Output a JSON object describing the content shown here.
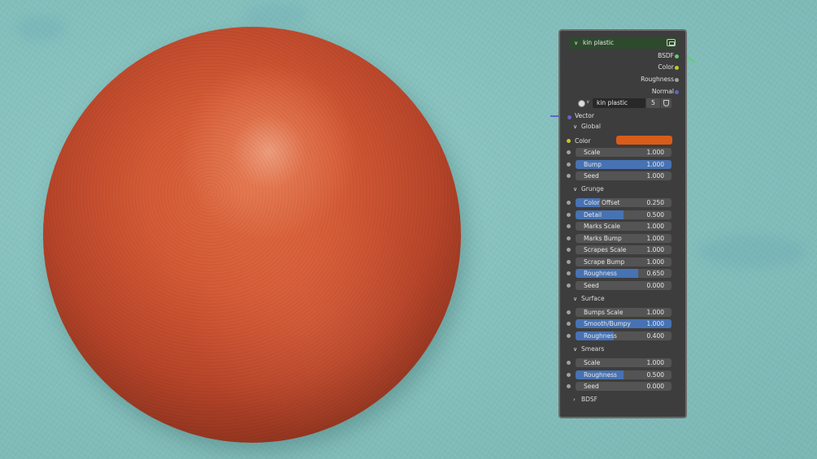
{
  "node": {
    "title": "kin plastic",
    "outputs": [
      {
        "label": "BSDF",
        "color": "#5fcf6b"
      },
      {
        "label": "Color",
        "color": "#c7c729"
      },
      {
        "label": "Roughness",
        "color": "#a1a1a1"
      },
      {
        "label": "Normal",
        "color": "#6363c7"
      }
    ],
    "datablock": {
      "name": "kin plastic",
      "users": "5"
    },
    "vector_label": "Vector",
    "vector_color": "#6363c7",
    "global": {
      "title": "Global",
      "color_label": "Color",
      "color_value": "#d95c1a",
      "fields": [
        {
          "label": "Scale",
          "value": "1.000",
          "fill": 0
        },
        {
          "label": "Bump",
          "value": "1.000",
          "fill": 1.0
        },
        {
          "label": "Seed",
          "value": "1.000",
          "fill": 0
        }
      ]
    },
    "grunge": {
      "title": "Grunge",
      "fields": [
        {
          "label": "Color Offset",
          "value": "0.250",
          "fill": 0.25
        },
        {
          "label": "Detail",
          "value": "0.500",
          "fill": 0.5
        },
        {
          "label": "Marks Scale",
          "value": "1.000",
          "fill": 0
        },
        {
          "label": "Marks Bump",
          "value": "1.000",
          "fill": 0
        },
        {
          "label": "Scrapes Scale",
          "value": "1.000",
          "fill": 0
        },
        {
          "label": "Scrape Bump",
          "value": "1.000",
          "fill": 0
        },
        {
          "label": "Roughness",
          "value": "0.650",
          "fill": 0.65
        },
        {
          "label": "Seed",
          "value": "0.000",
          "fill": 0
        }
      ]
    },
    "surface": {
      "title": "Surface",
      "fields": [
        {
          "label": "Bumps Scale",
          "value": "1.000",
          "fill": 0
        },
        {
          "label": "Smooth/Bumpy",
          "value": "1.000",
          "fill": 1.0
        },
        {
          "label": "Roughness",
          "value": "0.400",
          "fill": 0.4
        }
      ]
    },
    "smears": {
      "title": "Smears",
      "fields": [
        {
          "label": "Scale",
          "value": "1.000",
          "fill": 0
        },
        {
          "label": "Roughness",
          "value": "0.500",
          "fill": 0.5
        },
        {
          "label": "Seed",
          "value": "0.000",
          "fill": 0
        }
      ]
    },
    "bdsf": {
      "title": "BDSF"
    },
    "input_socket_color": "#a1a1a1",
    "color_socket_color": "#c7c729"
  }
}
